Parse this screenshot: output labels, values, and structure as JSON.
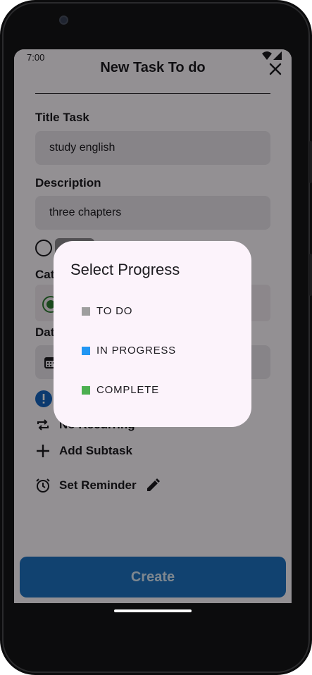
{
  "status_bar": {
    "time": "7:00"
  },
  "header": {
    "title": "New Task To do"
  },
  "form": {
    "title_label": "Title Task",
    "title_value": "study english",
    "description_label": "Description",
    "description_value": "three chapters",
    "category_label_partial": "Cat",
    "date_label_partial": "Dat",
    "recurring_label": "No Recurring",
    "add_subtask_label": "Add Subtask",
    "reminder_label": "Set Reminder"
  },
  "create_button": {
    "label": "Create"
  },
  "dialog": {
    "title": "Select Progress",
    "options": [
      {
        "label": "TO DO",
        "color": "#9e9e9e"
      },
      {
        "label": "IN PROGRESS",
        "color": "#2196f3"
      },
      {
        "label": "COMPLETE",
        "color": "#4caf50"
      }
    ]
  },
  "colors": {
    "accent": "#1e73c2",
    "category_selected": "#2e7d32",
    "info_icon": "#1565c0"
  }
}
